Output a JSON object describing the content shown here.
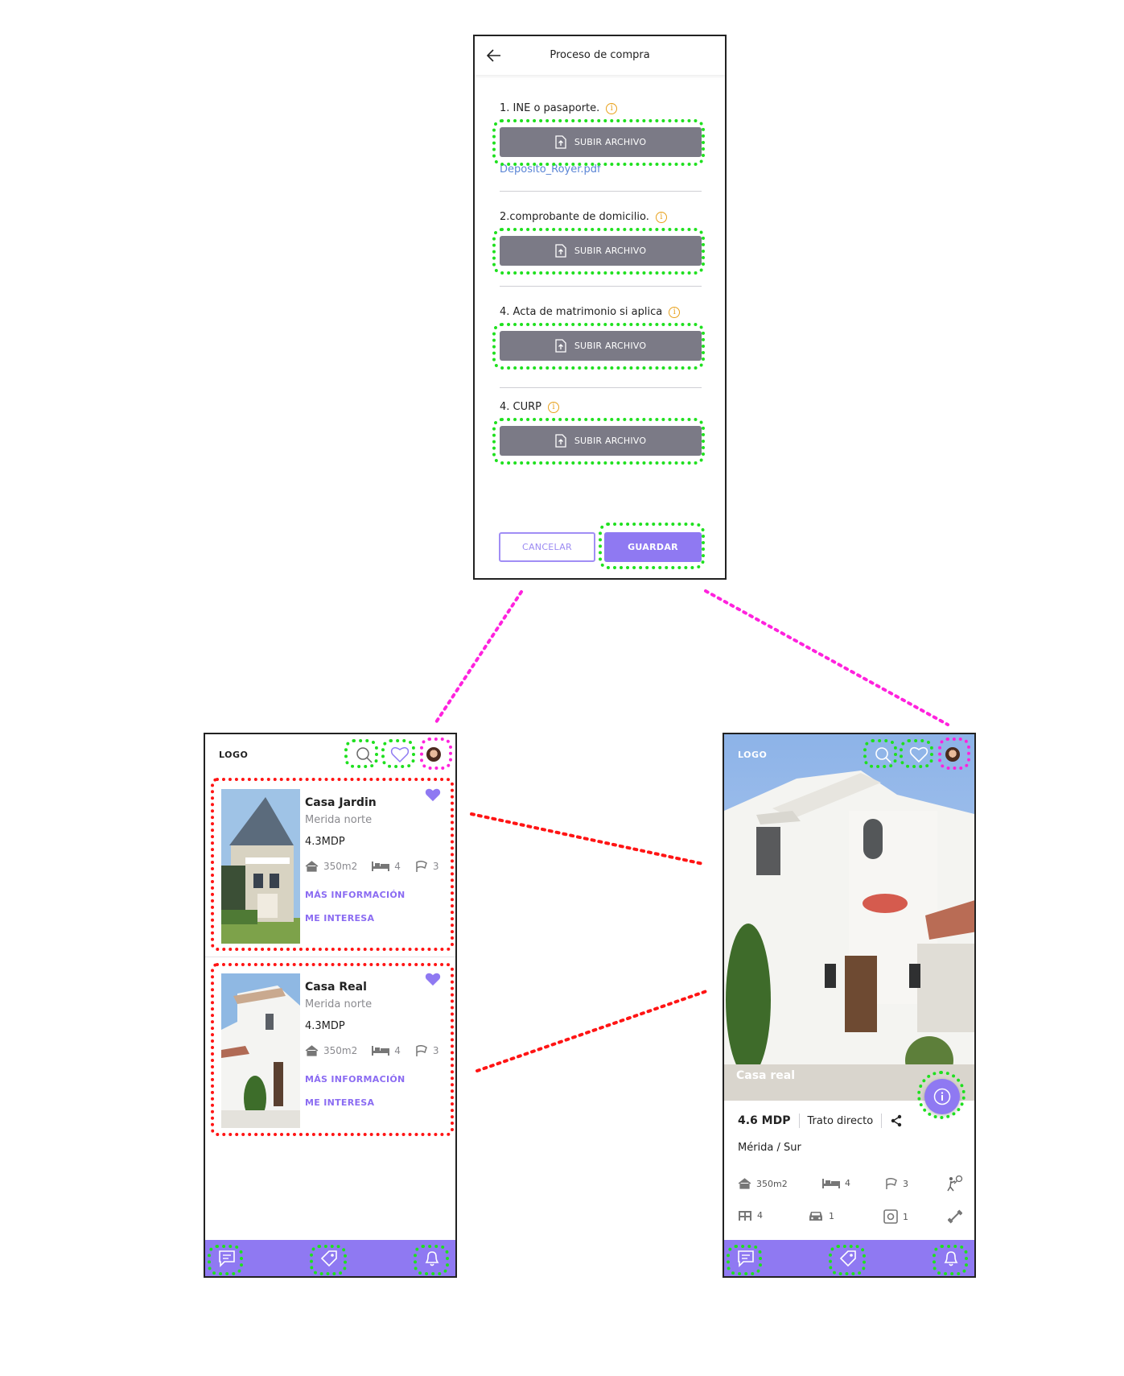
{
  "purchase": {
    "title": "Proceso de compra",
    "items": [
      {
        "label": "1. INE o pasaporte.",
        "button": "SUBIR ARCHIVO",
        "file": "Deposito_Royer.pdf"
      },
      {
        "label": "2.comprobante de domicilio.",
        "button": "SUBIR ARCHIVO"
      },
      {
        "label": "4. Acta de matrimonio si aplica",
        "button": "SUBIR ARCHIVO"
      },
      {
        "label": "4. CURP",
        "button": "SUBIR ARCHIVO"
      }
    ],
    "cancel": "CANCELAR",
    "save": "GUARDAR"
  },
  "listing": {
    "logo": "LOGO",
    "cards": [
      {
        "title": "Casa Jardin",
        "location": "Merida norte",
        "price": "4.3MDP",
        "area": "350m2",
        "beds": "4",
        "baths": "3",
        "more": "MÁS INFORMACIÓN",
        "interest": "ME INTERESA"
      },
      {
        "title": "Casa Real",
        "location": "Merida norte",
        "price": "4.3MDP",
        "area": "350m2",
        "beds": "4",
        "baths": "3",
        "more": "MÁS INFORMACIÓN",
        "interest": "ME INTERESA"
      }
    ]
  },
  "detail": {
    "logo": "LOGO",
    "photo_caption": "Casa real",
    "price": "4.6 MDP",
    "deal": "Trato directo",
    "location": "Mérida / Sur",
    "area": "350m2",
    "beds": "4",
    "baths": "3",
    "fence": "4",
    "cars": "1",
    "safe": "1"
  },
  "colors": {
    "accent": "#8f79f2",
    "button_gray": "#7b7a86",
    "info": "#e8a11c",
    "green_annotation": "#1fe01f",
    "magenta_annotation": "#ff22dd",
    "red_annotation": "#ff1414"
  },
  "icons": [
    "back-arrow-icon",
    "upload-icon",
    "info-icon",
    "search-icon",
    "heart-icon",
    "avatar",
    "home-icon",
    "bed-icon",
    "bath-icon",
    "share-icon",
    "tennis-icon",
    "fence-icon",
    "car-icon",
    "safe-icon",
    "gym-icon",
    "chat-icon",
    "tag-icon",
    "bell-icon"
  ]
}
